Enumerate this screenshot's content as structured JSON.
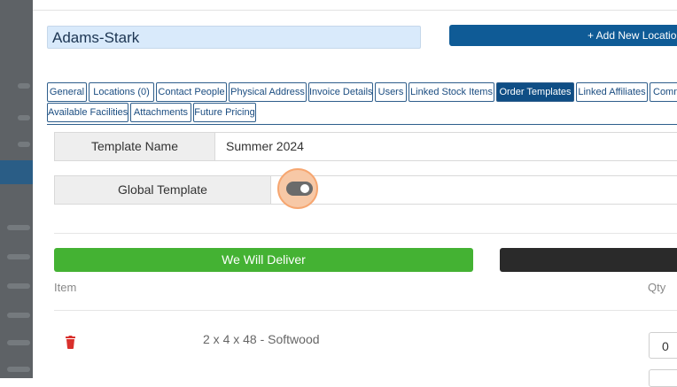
{
  "customer": {
    "name": "Adams-Stark"
  },
  "toolbar": {
    "add_location_label": "+ Add New Location"
  },
  "tabs": [
    "General",
    "Locations (0)",
    "Contact People",
    "Physical Address",
    "Invoice Details",
    "Users",
    "Linked Stock Items",
    "Order Templates",
    "Linked Affiliates",
    "Comm",
    "Available Facilities",
    "Attachments",
    "Future Pricing"
  ],
  "active_tab": "Order Templates",
  "form": {
    "template_name_label": "Template Name",
    "template_name_value": "Summer 2024",
    "global_template_label": "Global Template",
    "global_template_on": true
  },
  "actions": {
    "deliver_label": "We Will Deliver"
  },
  "table": {
    "headers": {
      "item": "Item",
      "qty": "Qty"
    },
    "rows": [
      {
        "item": "2 x 4 x 48 - Softwood",
        "qty": "0"
      }
    ]
  },
  "colors": {
    "primary": "#0f5b96",
    "deliver": "#44b233",
    "trash": "#d9302c",
    "focus_halo": "#f6a670"
  }
}
